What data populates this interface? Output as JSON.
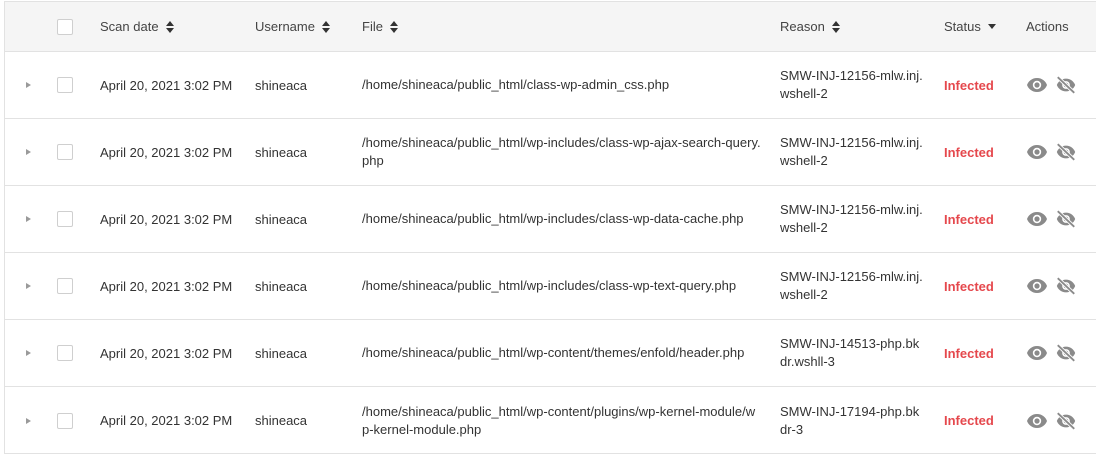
{
  "colors": {
    "status_infected": "#e5484d",
    "header_bg": "#f5f5f5",
    "border": "#e2e2e2",
    "icon": "#8a8a8a"
  },
  "headers": {
    "scan_date": "Scan date",
    "username": "Username",
    "file": "File",
    "reason": "Reason",
    "status": "Status",
    "actions": "Actions"
  },
  "icons": {
    "expand": "caret-right-icon",
    "sort": "sort-updown-icon",
    "sort_active": "sort-down-icon",
    "view": "eye-icon",
    "ignore": "eye-slash-icon"
  },
  "rows": [
    {
      "date": "April 20, 2021 3:02 PM",
      "user": "shineaca",
      "file": "/home/shineaca/public_html/class-wp-admin_css.php",
      "reason": "SMW-INJ-12156-mlw.inj.wshell-2",
      "status": "Infected"
    },
    {
      "date": "April 20, 2021 3:02 PM",
      "user": "shineaca",
      "file": "/home/shineaca/public_html/wp-includes/class-wp-ajax-search-query.php",
      "reason": "SMW-INJ-12156-mlw.inj.wshell-2",
      "status": "Infected"
    },
    {
      "date": "April 20, 2021 3:02 PM",
      "user": "shineaca",
      "file": "/home/shineaca/public_html/wp-includes/class-wp-data-cache.php",
      "reason": "SMW-INJ-12156-mlw.inj.wshell-2",
      "status": "Infected"
    },
    {
      "date": "April 20, 2021 3:02 PM",
      "user": "shineaca",
      "file": "/home/shineaca/public_html/wp-includes/class-wp-text-query.php",
      "reason": "SMW-INJ-12156-mlw.inj.wshell-2",
      "status": "Infected"
    },
    {
      "date": "April 20, 2021 3:02 PM",
      "user": "shineaca",
      "file": "/home/shineaca/public_html/wp-content/themes/enfold/header.php",
      "reason": "SMW-INJ-14513-php.bkdr.wshll-3",
      "status": "Infected"
    },
    {
      "date": "April 20, 2021 3:02 PM",
      "user": "shineaca",
      "file": "/home/shineaca/public_html/wp-content/plugins/wp-kernel-module/wp-kernel-module.php",
      "reason": "SMW-INJ-17194-php.bkdr-3",
      "status": "Infected"
    }
  ]
}
